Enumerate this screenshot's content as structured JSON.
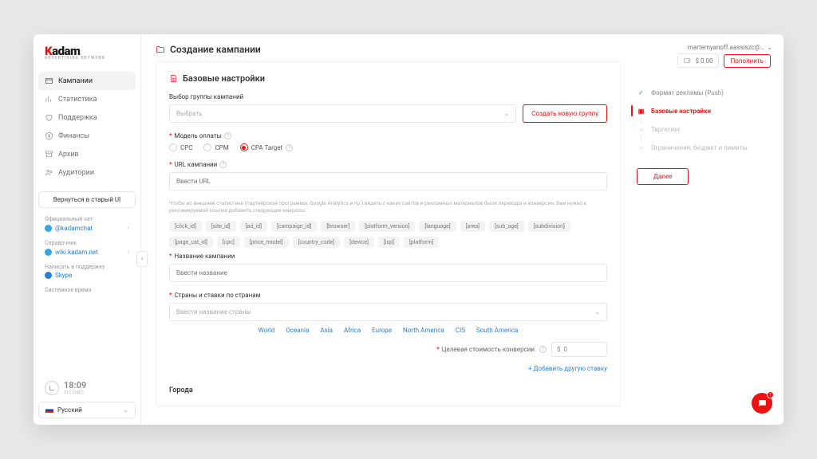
{
  "logo": {
    "brand": "adam"
  },
  "nav": [
    {
      "label": "Кампании"
    },
    {
      "label": "Статистика"
    },
    {
      "label": "Поддержка"
    },
    {
      "label": "Финансы"
    },
    {
      "label": "Архив"
    },
    {
      "label": "Аудитории"
    }
  ],
  "old_ui": "Вернуться в старый UI",
  "side": {
    "chat_t": "Официальный чат",
    "chat_v": "@kadamchat",
    "ref_t": "Справочник",
    "ref_v": "wiki.kadam.net",
    "support_t": "Написать в поддержку",
    "support_v": "Skype",
    "time_t": "Системное время",
    "time_v": "18:09",
    "time_sub": "UTC (GMT)"
  },
  "lang": "Русский",
  "page_title": "Создание кампании",
  "card_title": "Базовые настройки",
  "group": {
    "label": "Выбор группы кампаний",
    "placeholder": "Выбрать",
    "create": "Создать новую группу"
  },
  "pay": {
    "label": "Модель оплаты",
    "opts": [
      "CPC",
      "CPM",
      "CPA Target"
    ]
  },
  "url": {
    "label": "URL кампании",
    "placeholder": "Ввести URL"
  },
  "help": "Чтобы во внешней статистике (партнёрской программы, Google Analytics и пр.) видеть с каких сайтов и рекламных материалов были переходы и конверсии, Вам нужно к рекламируемой ссылке добавить следующие макросы:",
  "macros1": [
    "[click_id]",
    "[site_id]",
    "[ad_id]",
    "[campaign_id]",
    "[browser]",
    "[platform_version]",
    "[language]",
    "[area]",
    "[sub_age]",
    "[subdivision]"
  ],
  "macros2": [
    "[page_cat_id]",
    "[cpc]",
    "[price_model]",
    "[country_code]",
    "[device]",
    "[isp]",
    "[platform]"
  ],
  "name": {
    "label": "Название кампании",
    "placeholder": "Ввести название"
  },
  "countries": {
    "label": "Страны и ставки по странам",
    "placeholder": "Ввести название страны"
  },
  "regions": [
    "World",
    "Oceania",
    "Asia",
    "Africa",
    "Europe",
    "North America",
    "CIS",
    "South America"
  ],
  "conv": {
    "label": "Целевая стоимость конверсии",
    "currency": "$",
    "value": "0"
  },
  "add_rate": "+ Добавить другую ставку",
  "cities": "Города",
  "balance": {
    "amount": "$ 0.00",
    "topup": "Пополнить"
  },
  "user": "martemyanoff.aassiszc@…",
  "steps": [
    {
      "label": "Формат рекламы (Push)"
    },
    {
      "label": "Базовые настройки"
    },
    {
      "label": "Таргетинг"
    },
    {
      "label": "Ограничения, бюджет и лимиты"
    }
  ],
  "next": "Далее",
  "fab_badge": "1"
}
